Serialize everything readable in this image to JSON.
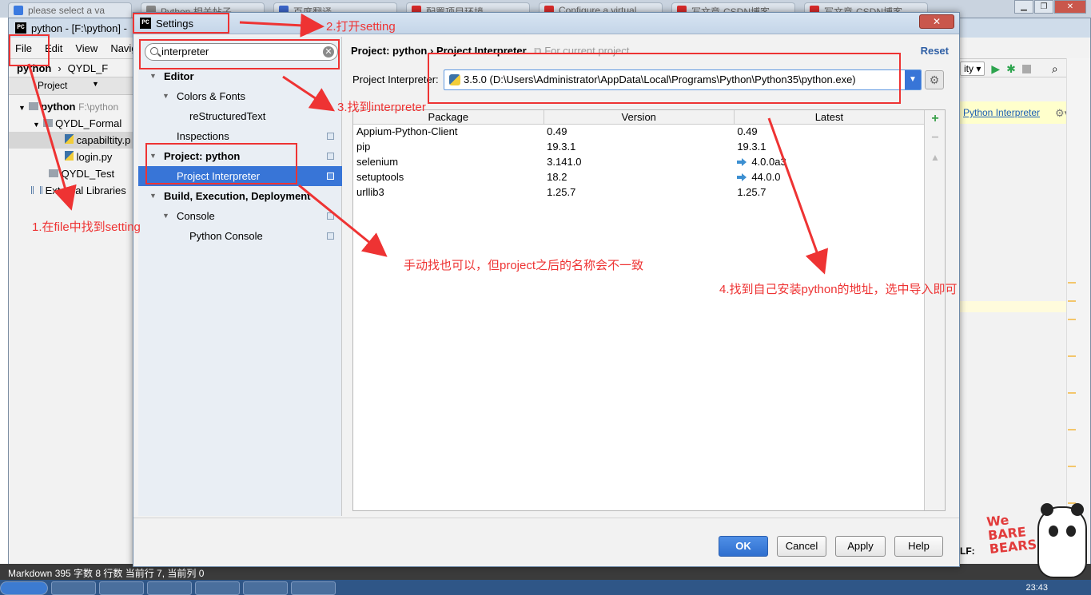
{
  "browser": {
    "tabs": [
      {
        "label": "please select a va",
        "color": "#3b7ae0"
      },
      {
        "label": "Python 相关帖子",
        "color": "#8a8a8a"
      },
      {
        "label": "百度翻译",
        "color": "#3c66cc"
      },
      {
        "label": "配置项目环境",
        "color": "#d92b2b"
      },
      {
        "label": "Configure a virtual",
        "color": "#d92b2b"
      },
      {
        "label": "写文章-CSDN博客",
        "color": "#d92b2b"
      },
      {
        "label": "写文章-CSDN博客",
        "color": "#d92b2b"
      }
    ]
  },
  "ide": {
    "title": "python - [F:\\python] -",
    "menu": [
      "File",
      "Edit",
      "View",
      "Navig"
    ],
    "nav": {
      "project": "python",
      "folder": "QYDL_F"
    },
    "project_tab": "Project",
    "tree": [
      {
        "label": "python",
        "path": "F:\\python"
      },
      {
        "label": "QYDL_Formal"
      },
      {
        "label": "capabiltity.p"
      },
      {
        "label": "login.py"
      },
      {
        "label": "QYDL_Test"
      },
      {
        "label": "External Libraries"
      }
    ],
    "toolbar_combo": "ity",
    "notice_link": "Python Interpreter",
    "encoding_fragment": "LF:",
    "status": "Markdown   395 字数   8 行数   当前行 7, 当前列 0",
    "clock": "23:43"
  },
  "dialog": {
    "title": "Settings",
    "search": {
      "value": "interpreter"
    },
    "tree": [
      {
        "label": "Editor",
        "bold": true,
        "indent": 32,
        "arrow": "▼"
      },
      {
        "label": "Colors & Fonts",
        "bold": false,
        "indent": 48,
        "arrow": "▼"
      },
      {
        "label": "reStructuredText",
        "bold": false,
        "indent": 64,
        "arrow": ""
      },
      {
        "label": "Inspections",
        "bold": false,
        "indent": 48,
        "arrow": ""
      },
      {
        "label": "Project: python",
        "bold": true,
        "indent": 32,
        "arrow": "▼"
      },
      {
        "label": "Project Interpreter",
        "bold": false,
        "indent": 48,
        "arrow": "",
        "selected": true
      },
      {
        "label": "Build, Execution, Deployment",
        "bold": true,
        "indent": 32,
        "arrow": "▼"
      },
      {
        "label": "Console",
        "bold": false,
        "indent": 48,
        "arrow": "▼"
      },
      {
        "label": "Python Console",
        "bold": false,
        "indent": 64,
        "arrow": ""
      }
    ],
    "breadcrumb": {
      "parent": "Project: python",
      "separator": "›",
      "current": "Project Interpreter",
      "note": "For current project"
    },
    "reset_label": "Reset",
    "interpreter_label": "Project Interpreter:",
    "interpreter_value": "3.5.0 (D:\\Users\\Administrator\\AppData\\Local\\Programs\\Python\\Python35\\python.exe)",
    "table": {
      "headers": [
        "Package",
        "Version",
        "Latest"
      ],
      "rows": [
        {
          "package": "Appium-Python-Client",
          "version": "0.49",
          "latest": "0.49",
          "upgrade": false
        },
        {
          "package": "pip",
          "version": "19.3.1",
          "latest": "19.3.1",
          "upgrade": false
        },
        {
          "package": "selenium",
          "version": "3.141.0",
          "latest": "4.0.0a3",
          "upgrade": true
        },
        {
          "package": "setuptools",
          "version": "18.2",
          "latest": "44.0.0",
          "upgrade": true
        },
        {
          "package": "urllib3",
          "version": "1.25.7",
          "latest": "1.25.7",
          "upgrade": false
        }
      ]
    },
    "buttons": {
      "ok": "OK",
      "cancel": "Cancel",
      "apply": "Apply",
      "help": "Help"
    }
  },
  "annotations": {
    "step1": "1.在file中找到setting",
    "step2": "2.打开setting",
    "step3": "3.找到interpreter",
    "manual_note": "手动找也可以，但project之后的名称会不一致",
    "step4": "4.找到自己安装python的地址，选中导入即可",
    "color": "#ee3333"
  },
  "sticker": {
    "lines": [
      "We",
      "BARE",
      "BEARS"
    ]
  }
}
